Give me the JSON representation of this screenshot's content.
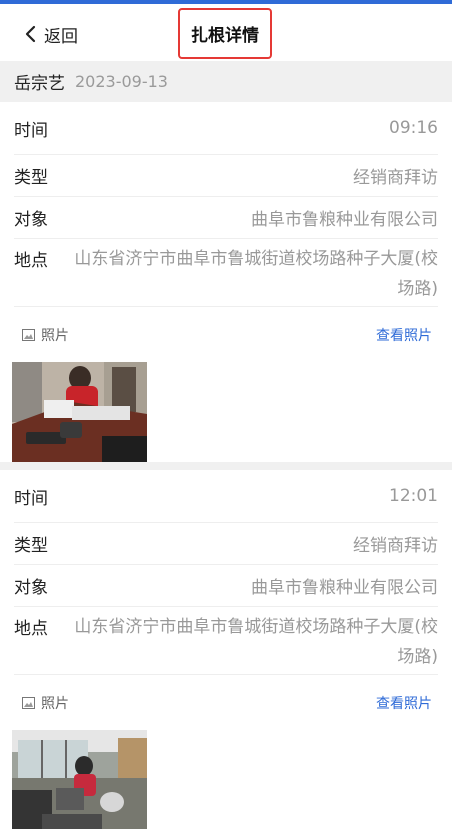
{
  "header": {
    "back_label": "返回",
    "title": "扎根详情",
    "accent_color": "#2f6bd7",
    "highlight_color": "#e53935"
  },
  "subheader": {
    "name": "岳宗艺",
    "date": "2023-09-13"
  },
  "records": [
    {
      "time_label": "时间",
      "time": "09:16",
      "type_label": "类型",
      "type": "经销商拜访",
      "target_label": "对象",
      "target": "曲阜市鲁粮种业有限公司",
      "location_label": "地点",
      "location": "山东省济宁市曲阜市鲁城街道校场路种子大厦(校场路)",
      "photo_label": "照片",
      "view_photos": "查看照片",
      "photo_icon": "image-icon"
    },
    {
      "time_label": "时间",
      "time": "12:01",
      "type_label": "类型",
      "type": "经销商拜访",
      "target_label": "对象",
      "target": "曲阜市鲁粮种业有限公司",
      "location_label": "地点",
      "location": "山东省济宁市曲阜市鲁城街道校场路种子大厦(校场路)",
      "photo_label": "照片",
      "view_photos": "查看照片",
      "photo_icon": "image-icon"
    }
  ]
}
